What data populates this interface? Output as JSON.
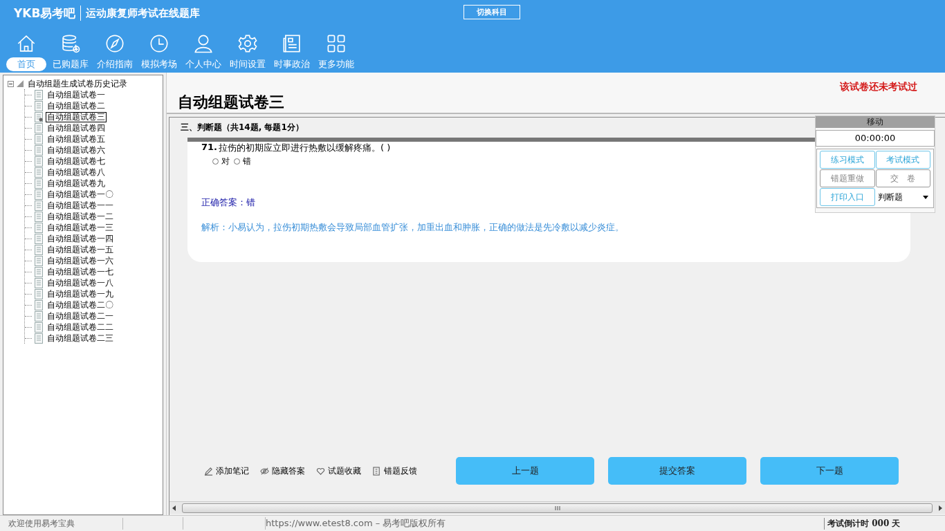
{
  "header": {
    "logo": "YKB易考吧",
    "title": "运动康复师考试在线题库",
    "switch_button": "切换科目"
  },
  "nav": [
    {
      "label": "首页",
      "selected": true
    },
    {
      "label": "已购题库",
      "selected": false
    },
    {
      "label": "介绍指南",
      "selected": false
    },
    {
      "label": "模拟考场",
      "selected": false
    },
    {
      "label": "个人中心",
      "selected": false
    },
    {
      "label": "时间设置",
      "selected": false
    },
    {
      "label": "时事政治",
      "selected": false
    },
    {
      "label": "更多功能",
      "selected": false
    }
  ],
  "tree": {
    "label": "自动组题生成试卷历史记录",
    "expanded": true,
    "children": [
      {
        "label": "自动组题试卷一",
        "selected": false
      },
      {
        "label": "自动组题试卷二",
        "selected": false
      },
      {
        "label": "自动组题试卷三",
        "selected": true
      },
      {
        "label": "自动组题试卷四",
        "selected": false
      },
      {
        "label": "自动组题试卷五",
        "selected": false
      },
      {
        "label": "自动组题试卷六",
        "selected": false
      },
      {
        "label": "自动组题试卷七",
        "selected": false
      },
      {
        "label": "自动组题试卷八",
        "selected": false
      },
      {
        "label": "自动组题试卷九",
        "selected": false
      },
      {
        "label": "自动组题试卷一〇",
        "selected": false
      },
      {
        "label": "自动组题试卷一一",
        "selected": false
      },
      {
        "label": "自动组题试卷一二",
        "selected": false
      },
      {
        "label": "自动组题试卷一三",
        "selected": false
      },
      {
        "label": "自动组题试卷一四",
        "selected": false
      },
      {
        "label": "自动组题试卷一五",
        "selected": false
      },
      {
        "label": "自动组题试卷一六",
        "selected": false
      },
      {
        "label": "自动组题试卷一七",
        "selected": false
      },
      {
        "label": "自动组题试卷一八",
        "selected": false
      },
      {
        "label": "自动组题试卷一九",
        "selected": false
      },
      {
        "label": "自动组题试卷二〇",
        "selected": false
      },
      {
        "label": "自动组题试卷二一",
        "selected": false
      },
      {
        "label": "自动组题试卷二二",
        "selected": false
      },
      {
        "label": "自动组题试卷二三",
        "selected": false
      }
    ]
  },
  "paper": {
    "title": "自动组题试卷三",
    "status": "该试卷还未考试过",
    "section": "三、判断题（共14题, 每题1分）",
    "question": {
      "number": "71.",
      "text": "拉伤的初期应立即进行热敷以缓解疼痛。( )",
      "options": [
        {
          "label": "对",
          "selected": false
        },
        {
          "label": "错",
          "selected": false
        }
      ],
      "answer": "正确答案：错",
      "explanation": "解析：小易认为，拉伤初期热敷会导致局部血管扩张，加重出血和肿胀，正确的做法是先冷敷以减少炎症。"
    }
  },
  "control_panel": {
    "title": "移动",
    "timer": "00:00:00",
    "buttons": [
      {
        "label": "练习模式",
        "disabled": false
      },
      {
        "label": "考试模式",
        "disabled": false
      },
      {
        "label": "错题重做",
        "disabled": true
      },
      {
        "label": "交　卷",
        "disabled": true
      },
      {
        "label": "打印入口",
        "disabled": false
      }
    ],
    "type_select": "判断题"
  },
  "tools": [
    "添加笔记",
    "隐藏答案",
    "试题收藏",
    "错题反馈"
  ],
  "actions": [
    "上一题",
    "提交答案",
    "下一题"
  ],
  "status_bar": {
    "welcome": "欢迎使用易考宝典",
    "copyright": "https://www.etest8.com – 易考吧版权所有",
    "countdown": "考试倒计时 000 天"
  }
}
